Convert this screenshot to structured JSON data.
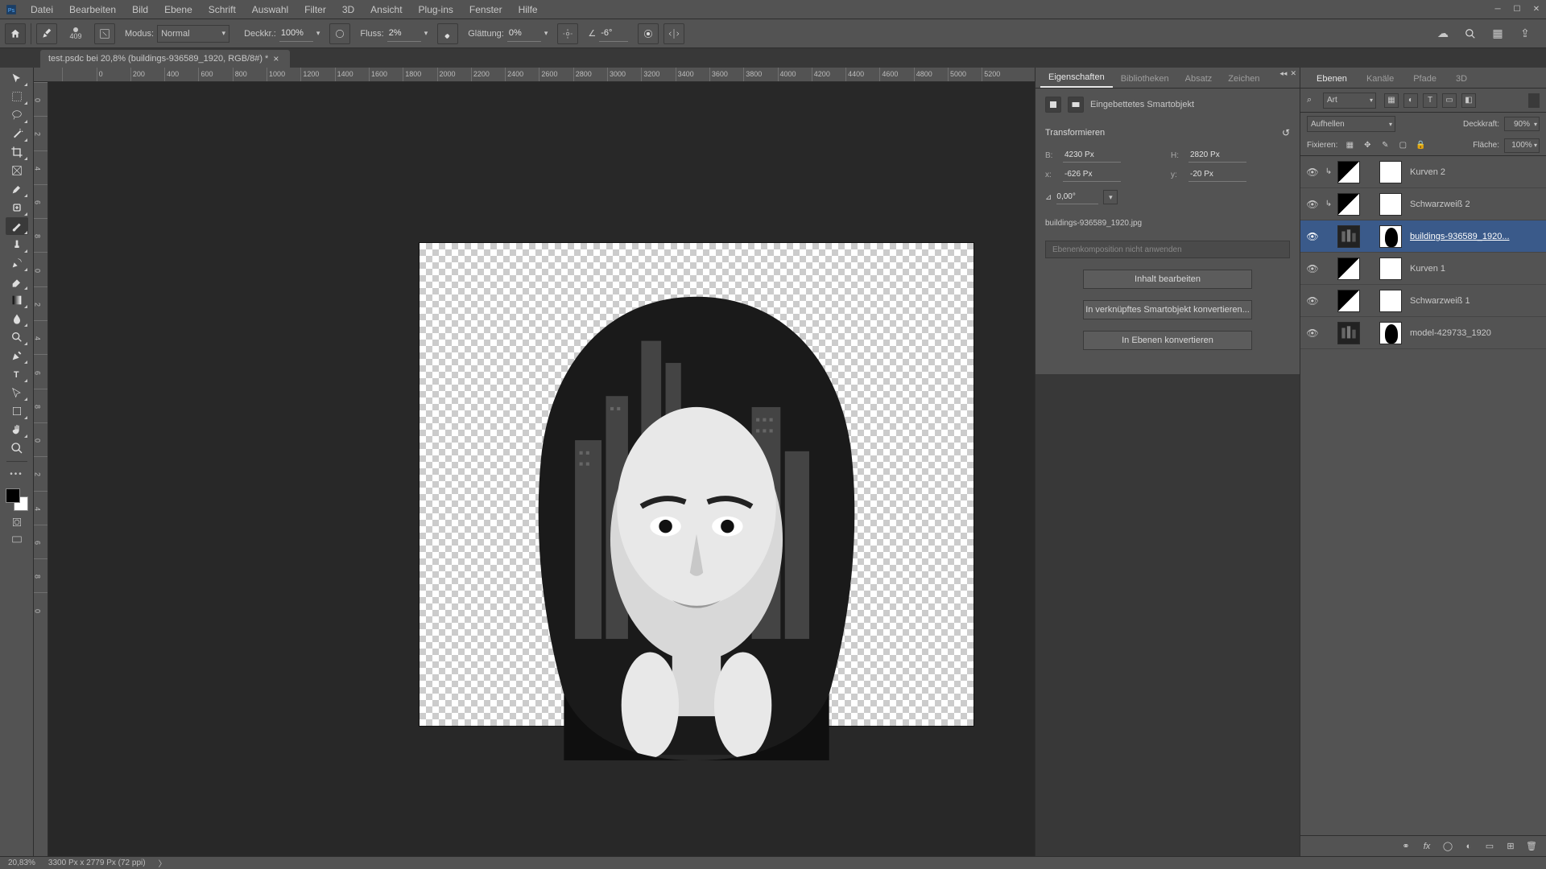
{
  "menu": [
    "Datei",
    "Bearbeiten",
    "Bild",
    "Ebene",
    "Schrift",
    "Auswahl",
    "Filter",
    "3D",
    "Ansicht",
    "Plug-ins",
    "Fenster",
    "Hilfe"
  ],
  "optionbar": {
    "brush_size": "409",
    "mode_label": "Modus:",
    "mode_value": "Normal",
    "opacity_label": "Deckkr.:",
    "opacity_value": "100%",
    "flow_label": "Fluss:",
    "flow_value": "2%",
    "smoothing_label": "Glättung:",
    "smoothing_value": "0%",
    "angle_label": "∠",
    "angle_value": "-6°"
  },
  "document": {
    "tab_title": "test.psdc bei 20,8% (buildings-936589_1920, RGB/8#) *"
  },
  "ruler_ticks": [
    "0",
    "200",
    "400",
    "600",
    "800",
    "1000",
    "1200",
    "1400",
    "1600",
    "1800",
    "2000",
    "2200",
    "2400",
    "2600",
    "2800",
    "3000",
    "3200",
    "3400",
    "3600",
    "3800",
    "4000",
    "4200",
    "4400",
    "4600",
    "4800",
    "5000",
    "5200"
  ],
  "ruler_ticks_v": [
    "0",
    "2",
    "4",
    "6",
    "8",
    "0",
    "2",
    "4",
    "6",
    "8",
    "0",
    "2",
    "4",
    "6",
    "8",
    "0"
  ],
  "properties": {
    "tabs": [
      "Eigenschaften",
      "Bibliotheken",
      "Absatz",
      "Zeichen"
    ],
    "object_type": "Eingebettetes Smartobjekt",
    "transform_title": "Transformieren",
    "width": "4230 Px",
    "height": "2820 Px",
    "x": "-626 Px",
    "y": "-20 Px",
    "angle": "0,00°",
    "filename": "buildings-936589_1920.jpg",
    "comp_placeholder": "Ebenenkomposition nicht anwenden",
    "btn_edit": "Inhalt bearbeiten",
    "btn_convert_linked": "In verknüpftes Smartobjekt konvertieren...",
    "btn_convert_layers": "In Ebenen konvertieren"
  },
  "layers_panel": {
    "tabs": [
      "Ebenen",
      "Kanäle",
      "Pfade",
      "3D"
    ],
    "filter_type": "Art",
    "blend_mode": "Aufhellen",
    "opacity_label": "Deckkraft:",
    "opacity_value": "90%",
    "lock_label": "Fixieren:",
    "fill_label": "Fläche:",
    "fill_value": "100%",
    "layers": [
      {
        "name": "Kurven 2",
        "type": "curves",
        "clipped": true
      },
      {
        "name": "Schwarzweiß 2",
        "type": "bw",
        "clipped": true
      },
      {
        "name": "buildings-936589_1920...",
        "type": "smart",
        "clipped": false,
        "selected": true
      },
      {
        "name": "Kurven 1",
        "type": "curves",
        "clipped": false
      },
      {
        "name": "Schwarzweiß 1",
        "type": "bw",
        "clipped": false
      },
      {
        "name": "model-429733_1920",
        "type": "smart",
        "clipped": false
      }
    ]
  },
  "status": {
    "zoom": "20,83%",
    "doc_info": "3300 Px x 2779 Px (72 ppi)"
  }
}
